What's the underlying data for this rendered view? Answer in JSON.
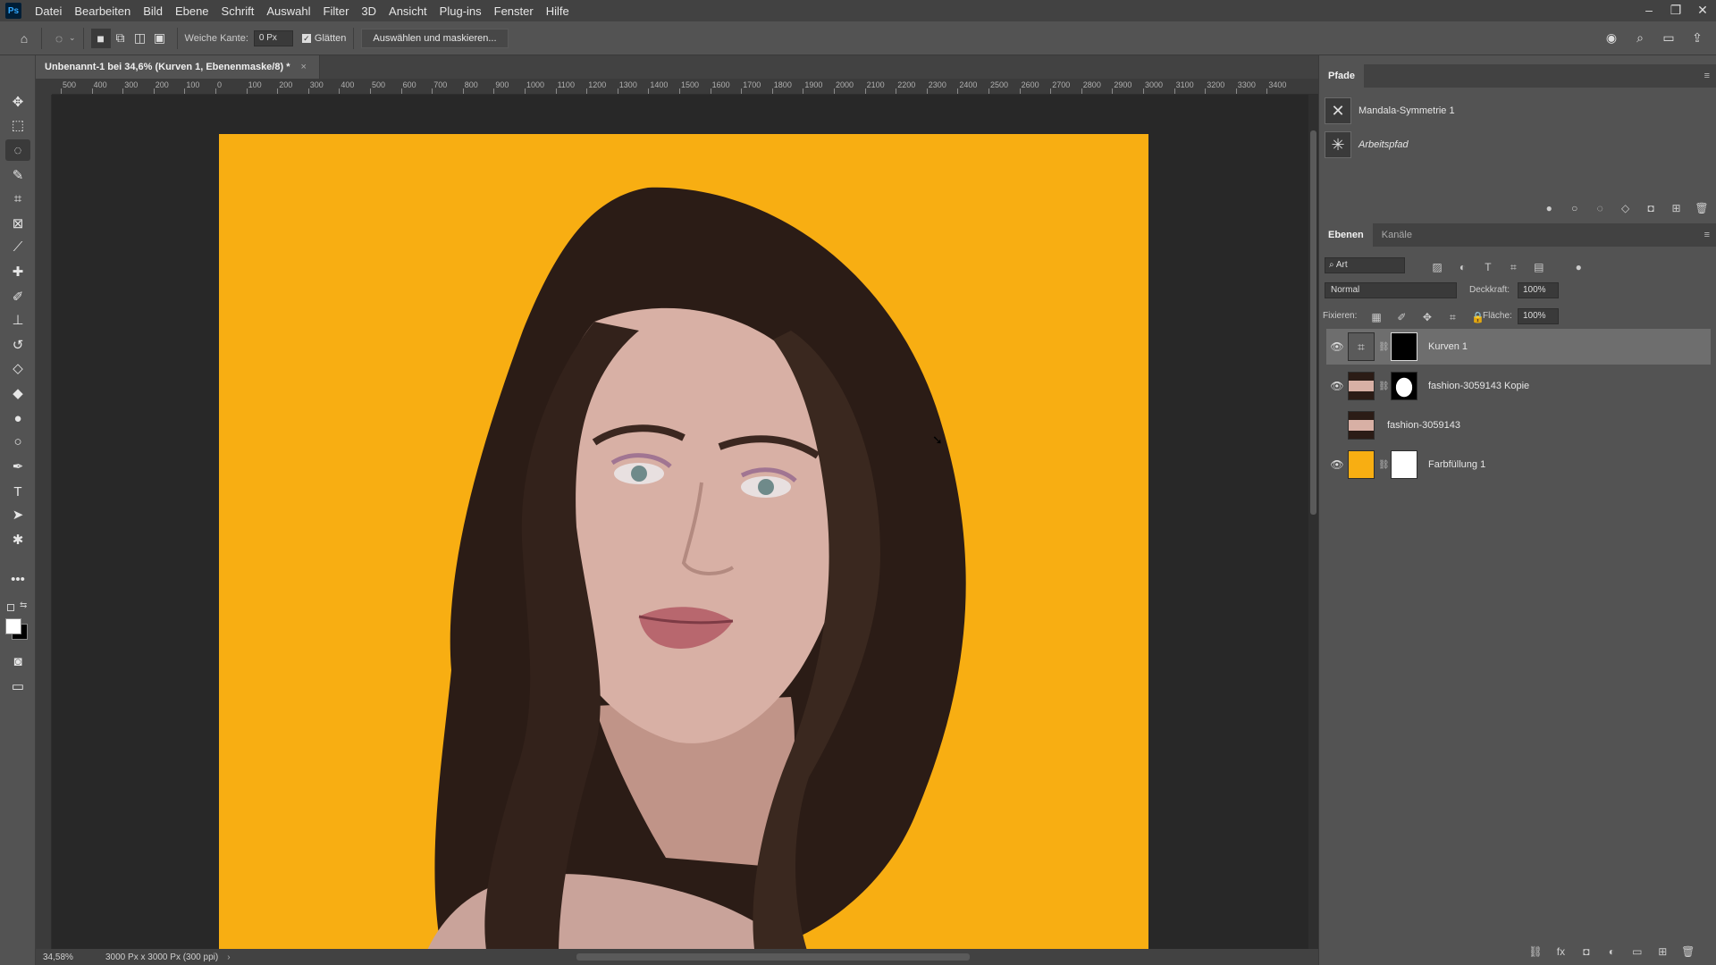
{
  "menu": {
    "logo": "Ps",
    "items": [
      "Datei",
      "Bearbeiten",
      "Bild",
      "Ebene",
      "Schrift",
      "Auswahl",
      "Filter",
      "3D",
      "Ansicht",
      "Plug-ins",
      "Fenster",
      "Hilfe"
    ]
  },
  "options": {
    "feather_label": "Weiche Kante:",
    "feather_value": "0 Px",
    "smooth_label": "Glätten",
    "select_mask_button": "Auswählen und maskieren..."
  },
  "document": {
    "tab_title": "Unbenannt-1 bei 34,6% (Kurven 1, Ebenenmaske/8) *",
    "ruler_labels": [
      "500",
      "400",
      "300",
      "200",
      "100",
      "0",
      "100",
      "200",
      "300",
      "400",
      "500",
      "600",
      "700",
      "800",
      "900",
      "1000",
      "1100",
      "1200",
      "1300",
      "1400",
      "1500",
      "1600",
      "1700",
      "1800",
      "1900",
      "2000",
      "2100",
      "2200",
      "2300",
      "2400",
      "2500",
      "2600",
      "2700",
      "2800",
      "2900",
      "3000",
      "3100",
      "3200",
      "3300",
      "3400"
    ],
    "canvas_color": "#f8ae12",
    "zoom": "34,58%",
    "doc_info": "3000 Px x 3000 Px (300 ppi)"
  },
  "paths_panel": {
    "title": "Pfade",
    "paths": [
      {
        "name": "Mandala-Symmetrie 1",
        "italic": false
      },
      {
        "name": "Arbeitspfad",
        "italic": true
      }
    ]
  },
  "layers_panel": {
    "tabs": [
      "Ebenen",
      "Kanäle"
    ],
    "filter_label": "Art",
    "blend_mode": "Normal",
    "opacity_label": "Deckkraft:",
    "opacity_value": "100%",
    "lock_label": "Fixieren:",
    "fill_label": "Fläche:",
    "fill_value": "100%",
    "layers": [
      {
        "name": "Kurven 1",
        "visible": true,
        "selected": true,
        "thumb": "curves",
        "mask": "black"
      },
      {
        "name": "fashion-3059143 Kopie",
        "visible": true,
        "selected": false,
        "thumb": "photo",
        "mask": "silhouette"
      },
      {
        "name": "fashion-3059143",
        "visible": false,
        "selected": false,
        "thumb": "photo",
        "mask": "none"
      },
      {
        "name": "Farbfüllung 1",
        "visible": true,
        "selected": false,
        "thumb": "fill",
        "mask": "white"
      }
    ]
  },
  "colors": {
    "accent_fill": "#f8ae12",
    "panel_bg": "#535353",
    "dark_bg": "#282828"
  }
}
